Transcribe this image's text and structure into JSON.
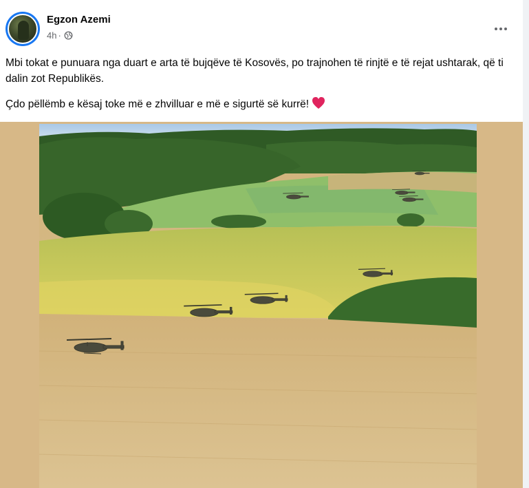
{
  "post": {
    "author": "Egzon Azemi",
    "time": "4h",
    "separator": "·",
    "audience_icon": "globe-icon",
    "more_icon": "more-options-icon",
    "paragraph1": "Mbi tokat e punuara nga duart e arta të bujqëve të Kosovës, po trajnohen të rinjtë e të rejat ushtarak, që ti dalin zot Republikës.",
    "paragraph2": "Çdo pëllëmb e kësaj toke më e zhvilluar e më e sigurtë së kurrë!",
    "emoji": "red-heart-icon"
  },
  "media": {
    "image_subject": "helicopters-over-fields-photo"
  },
  "colors": {
    "accent": "#1877f2",
    "text": "#050505",
    "secondary_text": "#65676b",
    "media_background": "#d7b887",
    "heart": "#e0245e"
  }
}
